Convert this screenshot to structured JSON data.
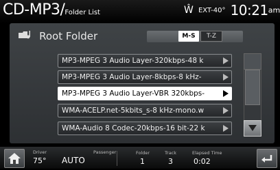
{
  "header": {
    "title": "CD-MP3/",
    "subtitle": "Folder List",
    "status_icon": "wireless-icon",
    "outside_temp": "EXT-40°",
    "time": "10:21",
    "ampm": "am"
  },
  "folder": {
    "icon": "music-folder-icon",
    "label": "Root Folder"
  },
  "sort": {
    "ms_label": "M-S",
    "tz_label": "T-Z"
  },
  "tracks": [
    {
      "label": "MP3-MPEG 3 Audio Layer-320kbps-48 k",
      "selected": false
    },
    {
      "label": "MP3-MPEG 3 Audio Layer-8kbps-8 kHz-",
      "selected": false
    },
    {
      "label": "MP3-MPEG 3 Audio Layer-VBR 320kbps-",
      "selected": true
    },
    {
      "label": "WMA-ACELP.net-5kbits_s-8 kHz-mono.w",
      "selected": false
    },
    {
      "label": "WMA-Audio 8 Codec-20kbps-16 bit-22 k",
      "selected": false
    }
  ],
  "bottom": {
    "driver_label": "Driver",
    "driver_temp": "75°",
    "auto_label": "AUTO",
    "passenger_label": "Passenger",
    "folder_label": "Folder",
    "folder_value": "1",
    "track_label": "Track",
    "track_value": "3",
    "elapsed_label": "Elapsed Time",
    "elapsed_value": "0:02"
  }
}
